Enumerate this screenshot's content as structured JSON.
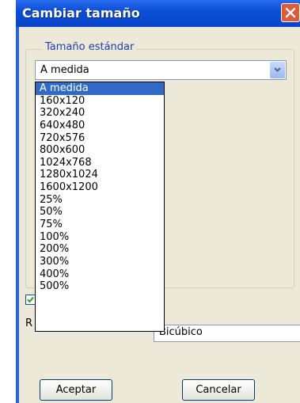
{
  "window": {
    "title": "Cambiar tamaño"
  },
  "group": {
    "legend": "Tamaño estándar"
  },
  "combo": {
    "value": "A medida"
  },
  "dropdown": {
    "items": [
      "A medida",
      "160x120",
      "320x240",
      "640x480",
      "720x576",
      "800x600",
      "1024x768",
      "1280x1024",
      "1600x1200",
      "25%",
      "50%",
      "75%",
      "100%",
      "200%",
      "300%",
      "400%",
      "500%"
    ],
    "selected_index": 0
  },
  "lower": {
    "row_label_fragment": "R",
    "combo_value_fragment": "Bicúbico"
  },
  "buttons": {
    "ok": "Aceptar",
    "cancel": "Cancelar"
  },
  "colors": {
    "title_bar": "#0a4fd6",
    "selection": "#316ac5",
    "window_bg": "#ece9d8"
  }
}
